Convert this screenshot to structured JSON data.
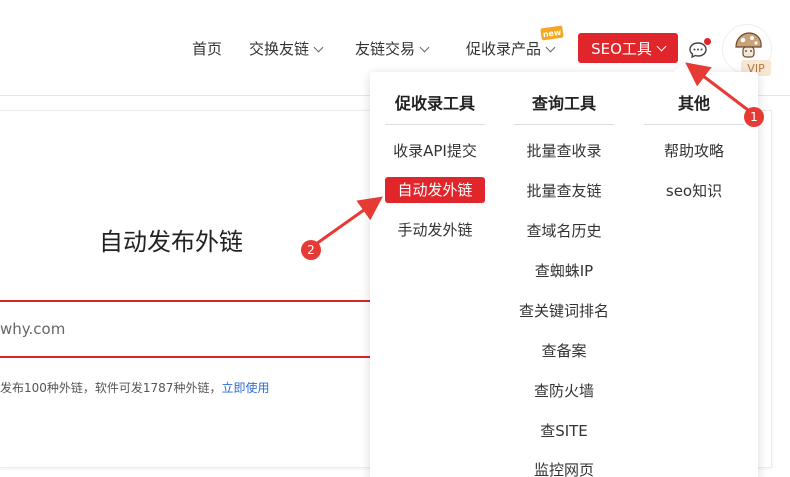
{
  "nav": {
    "items": [
      {
        "label": "首页",
        "has_chevron": false
      },
      {
        "label": "交换友链",
        "has_chevron": true
      },
      {
        "label": "友链交易",
        "has_chevron": true
      },
      {
        "label": "促收录产品",
        "has_chevron": true
      }
    ],
    "new_badge": "new",
    "seo_button": "SEO工具",
    "vip_badge": "VIP"
  },
  "main": {
    "title": "自动发布外链",
    "input_value": "why.com",
    "info_text": "发布100种外链，软件可发1787种外链，",
    "info_link": "立即使用"
  },
  "dropdown": {
    "columns": [
      {
        "heading": "促收录工具",
        "items": [
          "收录API提交",
          "自动发外链",
          "手动发外链"
        ]
      },
      {
        "heading": "查询工具",
        "items": [
          "批量查收录",
          "批量查友链",
          "查域名历史",
          "查蜘蛛IP",
          "查关键词排名",
          "查备案",
          "查防火墙",
          "查SITE",
          "监控网页"
        ]
      },
      {
        "heading": "其他",
        "items": [
          "帮助攻略",
          "seo知识"
        ]
      }
    ],
    "active_item": "自动发外链"
  },
  "annotations": {
    "marker_1": "1",
    "marker_2": "2"
  },
  "colors": {
    "brand_red": "#e0262b",
    "link_blue": "#2b6dd8",
    "badge_orange": "#f5a623"
  }
}
